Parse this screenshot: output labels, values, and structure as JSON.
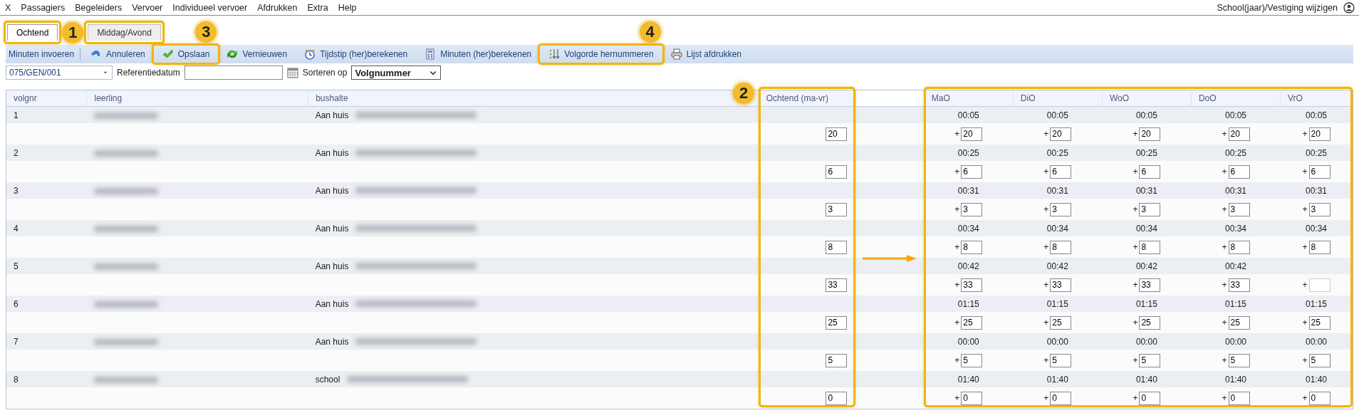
{
  "menu": {
    "items": [
      "X",
      "Passagiers",
      "Begeleiders",
      "Vervoer",
      "Individueel vervoer",
      "Afdrukken",
      "Extra",
      "Help"
    ],
    "account": "School(jaar)/Vestiging wijzigen"
  },
  "tabs": [
    {
      "label": "Ochtend",
      "selected": true,
      "highlighted": true,
      "callout": "1"
    },
    {
      "label": "Middag/Avond",
      "selected": false,
      "highlighted": true
    }
  ],
  "toolbar": {
    "label": "Minuten invoeren",
    "buttons": [
      {
        "label": "Annuleren"
      },
      {
        "label": "Opslaan",
        "highlighted": true,
        "callout": "3"
      },
      {
        "label": "Vernieuwen"
      },
      {
        "label": "Tijdstip (her)berekenen"
      },
      {
        "label": "Minuten (her)berekenen"
      },
      {
        "label": "Volgorde hernummeren",
        "highlighted": true,
        "callout": "4"
      },
      {
        "label": "Lijst afdrukken"
      }
    ]
  },
  "filters": {
    "route": "075/GEN/001",
    "date_label": "Referentiedatum",
    "sort_label": "Sorteren op",
    "sort_value": "Volgnummer"
  },
  "table": {
    "columns": [
      "volgnr",
      "leerling",
      "bushalte",
      "Ochtend (ma-vr)",
      "MaO",
      "DiO",
      "WoO",
      "DoO",
      "VrO"
    ],
    "callout": "2",
    "arrow": true,
    "rows": [
      {
        "volgnr": "1",
        "name_blurred": true,
        "stop": "Aan huis",
        "address_blurred": true,
        "minutes": "20",
        "days": [
          {
            "time": "00:05",
            "sign": "+",
            "minutes": "20"
          },
          {
            "time": "00:05",
            "sign": "+",
            "minutes": "20"
          },
          {
            "time": "00:05",
            "sign": "+",
            "minutes": "20"
          },
          {
            "time": "00:05",
            "sign": "+",
            "minutes": "20"
          },
          {
            "time": "00:05",
            "sign": "+",
            "minutes": "20"
          }
        ]
      },
      {
        "volgnr": "2",
        "name_blurred": true,
        "stop": "Aan huis",
        "address_blurred": true,
        "minutes": "6",
        "days": [
          {
            "time": "00:25",
            "sign": "+",
            "minutes": "6"
          },
          {
            "time": "00:25",
            "sign": "+",
            "minutes": "6"
          },
          {
            "time": "00:25",
            "sign": "+",
            "minutes": "6"
          },
          {
            "time": "00:25",
            "sign": "+",
            "minutes": "6"
          },
          {
            "time": "00:25",
            "sign": "+",
            "minutes": "6"
          }
        ]
      },
      {
        "volgnr": "3",
        "name_blurred": true,
        "stop": "Aan huis",
        "address_blurred": true,
        "minutes": "3",
        "days": [
          {
            "time": "00:31",
            "sign": "+",
            "minutes": "3"
          },
          {
            "time": "00:31",
            "sign": "+",
            "minutes": "3"
          },
          {
            "time": "00:31",
            "sign": "+",
            "minutes": "3"
          },
          {
            "time": "00:31",
            "sign": "+",
            "minutes": "3"
          },
          {
            "time": "00:31",
            "sign": "+",
            "minutes": "3"
          }
        ]
      },
      {
        "volgnr": "4",
        "name_blurred": true,
        "stop": "Aan huis",
        "address_blurred": true,
        "minutes": "8",
        "days": [
          {
            "time": "00:34",
            "sign": "+",
            "minutes": "8"
          },
          {
            "time": "00:34",
            "sign": "+",
            "minutes": "8"
          },
          {
            "time": "00:34",
            "sign": "+",
            "minutes": "8"
          },
          {
            "time": "00:34",
            "sign": "+",
            "minutes": "8"
          },
          {
            "time": "00:34",
            "sign": "+",
            "minutes": "8"
          }
        ]
      },
      {
        "volgnr": "5",
        "name_blurred": true,
        "stop": "Aan huis",
        "address_blurred": true,
        "minutes": "33",
        "days": [
          {
            "time": "00:42",
            "sign": "+",
            "minutes": "33"
          },
          {
            "time": "00:42",
            "sign": "+",
            "minutes": "33"
          },
          {
            "time": "00:42",
            "sign": "+",
            "minutes": "33"
          },
          {
            "time": "00:42",
            "sign": "+",
            "minutes": "33"
          },
          {
            "sign": "+"
          }
        ]
      },
      {
        "volgnr": "6",
        "name_blurred": true,
        "stop": "Aan huis",
        "address_blurred": true,
        "minutes": "25",
        "days": [
          {
            "time": "01:15",
            "sign": "+",
            "minutes": "25"
          },
          {
            "time": "01:15",
            "sign": "+",
            "minutes": "25"
          },
          {
            "time": "01:15",
            "sign": "+",
            "minutes": "25"
          },
          {
            "time": "01:15",
            "sign": "+",
            "minutes": "25"
          },
          {
            "time": "01:15",
            "sign": "+",
            "minutes": "25"
          }
        ]
      },
      {
        "volgnr": "7",
        "name_blurred": true,
        "stop": "Aan huis",
        "address_blurred": true,
        "minutes": "5",
        "days": [
          {
            "time": "00:00",
            "sign": "+",
            "minutes": "5"
          },
          {
            "time": "00:00",
            "sign": "+",
            "minutes": "5"
          },
          {
            "time": "00:00",
            "sign": "+",
            "minutes": "5"
          },
          {
            "time": "00:00",
            "sign": "+",
            "minutes": "5"
          },
          {
            "time": "00:00",
            "sign": "+",
            "minutes": "5"
          }
        ]
      },
      {
        "volgnr": "8",
        "name_blurred": true,
        "stop": "school",
        "address_blurred": true,
        "minutes": "0",
        "days": [
          {
            "time": "01:40",
            "sign": "+",
            "minutes": "0"
          },
          {
            "time": "01:40",
            "sign": "+",
            "minutes": "0"
          },
          {
            "time": "01:40",
            "sign": "+",
            "minutes": "0"
          },
          {
            "time": "01:40",
            "sign": "+",
            "minutes": "0"
          },
          {
            "time": "01:40",
            "sign": "+",
            "minutes": "0"
          }
        ]
      }
    ]
  }
}
